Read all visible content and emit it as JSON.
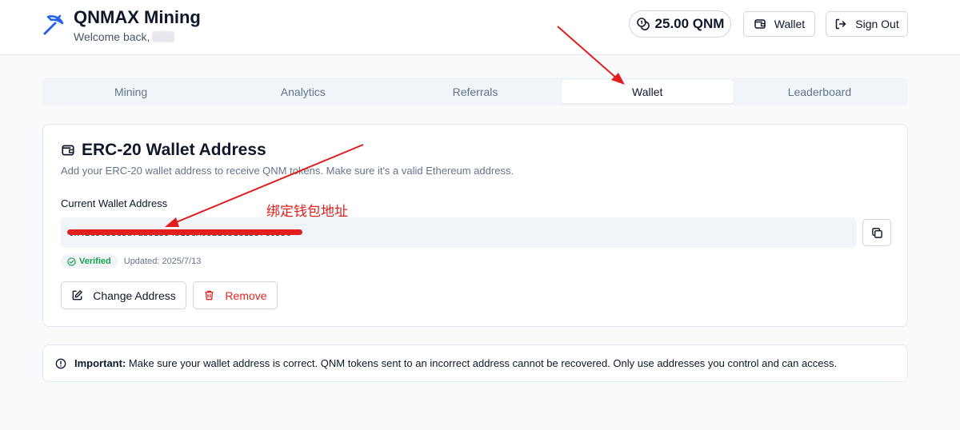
{
  "header": {
    "app_title": "QNMAX Mining",
    "welcome": "Welcome back,",
    "balance": "25.00 QNM",
    "wallet_label": "Wallet",
    "signout_label": "Sign Out"
  },
  "tabs": [
    {
      "label": "Mining",
      "active": false
    },
    {
      "label": "Analytics",
      "active": false
    },
    {
      "label": "Referrals",
      "active": false
    },
    {
      "label": "Wallet",
      "active": true
    },
    {
      "label": "Leaderboard",
      "active": false
    }
  ],
  "wallet_card": {
    "title": "ERC-20 Wallet Address",
    "description": "Add your ERC-20 wallet address to receive QNM tokens. Make sure it's a valid Ethereum address.",
    "field_label": "Current Wallet Address",
    "address": "0x42e5033d5b7abb1354513eA0b2E631e1337e6556",
    "verified_label": "Verified",
    "updated": "Updated: 2025/7/13",
    "change_label": "Change Address",
    "remove_label": "Remove"
  },
  "notice": {
    "strong": "Important:",
    "text": "Make sure your wallet address is correct. QNM tokens sent to an incorrect address cannot be recovered. Only use addresses you control and can access."
  },
  "annotation": {
    "text": "绑定钱包地址",
    "color": "#e11d1d"
  },
  "colors": {
    "accent": "#2563eb",
    "danger": "#dc2626",
    "success": "#16a34a"
  }
}
